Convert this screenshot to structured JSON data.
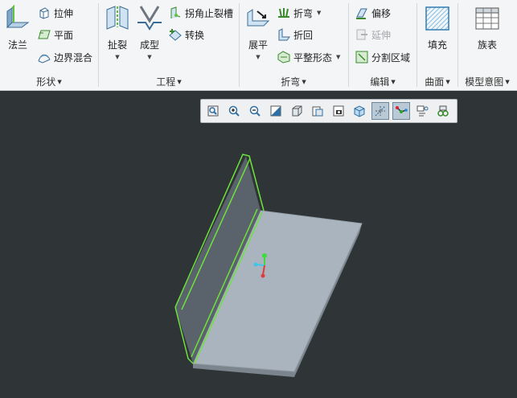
{
  "ribbon": {
    "groups": [
      {
        "label": "形状"
      },
      {
        "label": "工程"
      },
      {
        "label": "折弯"
      },
      {
        "label": "编辑"
      },
      {
        "label": "曲面"
      },
      {
        "label": "模型意图"
      }
    ],
    "shape": {
      "flange": "法兰",
      "extrude": "拉伸",
      "plane": "平面",
      "boundary_blend": "边界混合"
    },
    "engineering": {
      "rip": "扯裂",
      "form": "成型",
      "corner_relief": "拐角止裂槽",
      "convert": "转换"
    },
    "bend": {
      "unbend": "展平",
      "bend": "折弯",
      "bend_back": "折回",
      "flat_pattern": "平整形态"
    },
    "edit": {
      "offset": "偏移",
      "extend": "延伸",
      "split_area": "分割区域"
    },
    "surface": {
      "fill": "填充"
    },
    "model_intent": {
      "family_table": "族表"
    }
  },
  "colors": {
    "background": "#2f3436",
    "part": "#a9b4bf",
    "part_wall": "#5a626c",
    "selection": "#6de33b"
  },
  "view_toolbar_icons": [
    "refit-icon",
    "zoom-in-icon",
    "zoom-out-icon",
    "repaint-icon",
    "display-style-icon",
    "saved-orientations-icon",
    "named-views-icon",
    "perspective-icon",
    "datum-display-icon",
    "spin-center-icon",
    "annotation-display-icon",
    "appearance-icon"
  ]
}
